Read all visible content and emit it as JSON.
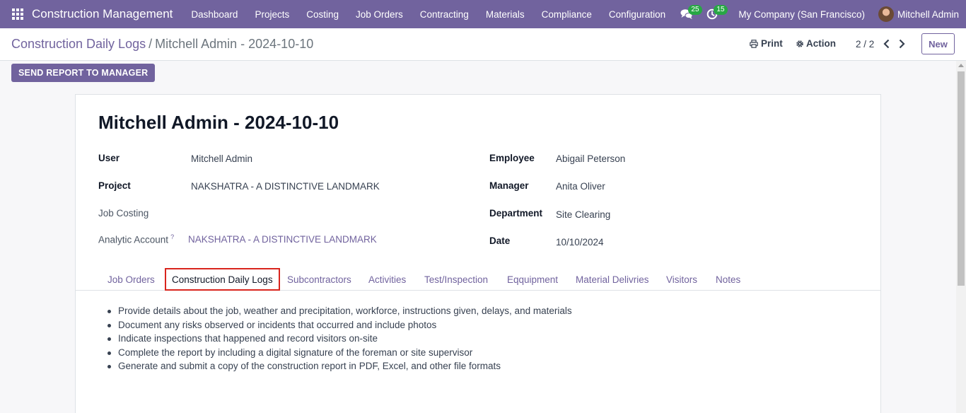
{
  "navbar": {
    "brand": "Construction Management",
    "menu": [
      "Dashboard",
      "Projects",
      "Costing",
      "Job Orders",
      "Contracting",
      "Materials",
      "Compliance",
      "Configuration"
    ],
    "messages_badge": "25",
    "activities_badge": "15",
    "company": "My Company (San Francisco)",
    "user": "Mitchell Admin"
  },
  "control": {
    "breadcrumb_parent": "Construction Daily Logs",
    "breadcrumb_separator": "/",
    "breadcrumb_current": "Mitchell Admin - 2024-10-10",
    "print_label": "Print",
    "action_label": "Action",
    "pager": "2 / 2",
    "new_label": "New"
  },
  "status_bar": {
    "send_report_label": "SEND REPORT TO MANAGER"
  },
  "record": {
    "title": "Mitchell Admin - 2024-10-10",
    "left_fields": {
      "user_label": "User",
      "user_value": "Mitchell Admin",
      "project_label": "Project",
      "project_value": "NAKSHATRA - A DISTINCTIVE LANDMARK",
      "job_costing_label": "Job Costing",
      "job_costing_value": "",
      "analytic_label": "Analytic Account",
      "analytic_help": "?",
      "analytic_value": "NAKSHATRA - A DISTINCTIVE LANDMARK"
    },
    "right_fields": {
      "employee_label": "Employee",
      "employee_value": "Abigail Peterson",
      "manager_label": "Manager",
      "manager_value": "Anita Oliver",
      "department_label": "Department",
      "department_value": "Site Clearing",
      "date_label": "Date",
      "date_value": "10/10/2024"
    },
    "tabs": [
      "Job Orders",
      "Construction Daily Logs",
      "Subcontractors",
      "Activities",
      "Test/Inspection",
      "Eqquipment",
      "Material Delivries",
      "Visitors",
      "Notes"
    ],
    "active_tab": "Construction Daily Logs",
    "notes": [
      "Provide details about the job, weather and precipitation, workforce, instructions given, delays, and materials",
      "Document any risks observed or incidents that occurred and include photos",
      "Indicate inspections that happened and record visitors on-site",
      "Complete the report by including a digital signature of the foreman or site supervisor",
      "Generate and submit a copy of the construction report in PDF, Excel, and other file formats"
    ]
  },
  "colors": {
    "brand": "#71639e",
    "badge": "#28a745",
    "active_tab_outline": "#d9251d"
  }
}
